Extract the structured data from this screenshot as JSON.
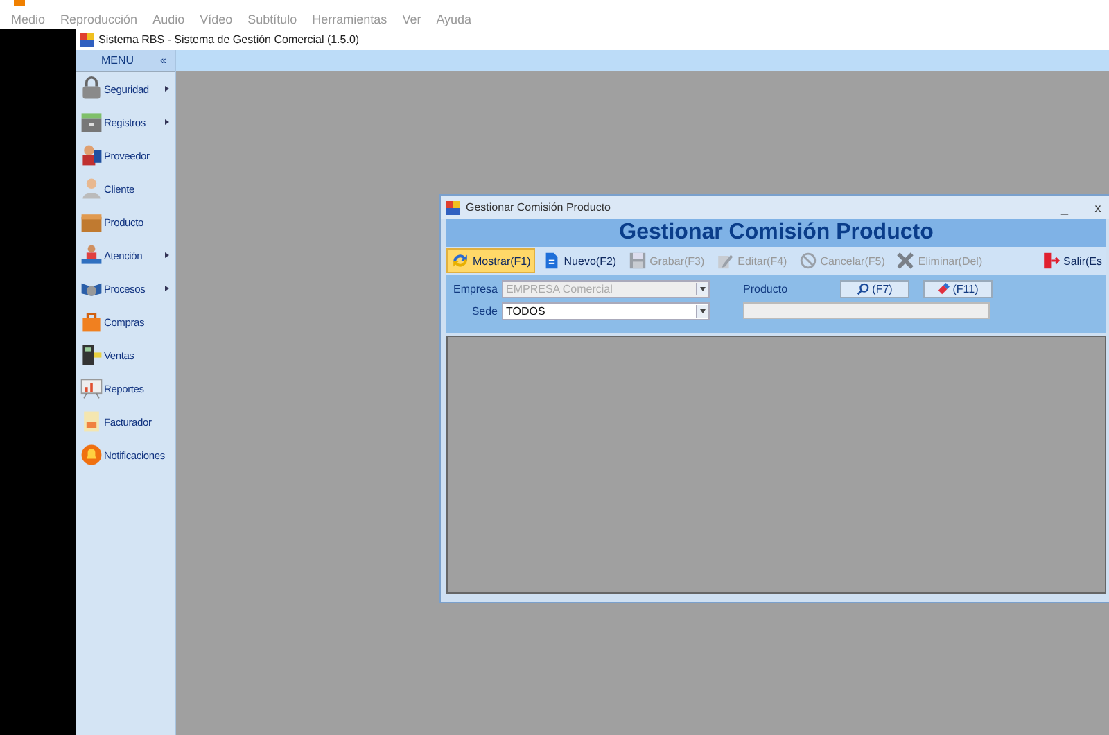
{
  "player_menu": [
    {
      "label": "Medio"
    },
    {
      "label": "Reproducción"
    },
    {
      "label": "Audio"
    },
    {
      "label": "Vídeo"
    },
    {
      "label": "Subtítulo"
    },
    {
      "label": "Herramientas"
    },
    {
      "label": "Ver"
    },
    {
      "label": "Ayuda"
    }
  ],
  "window": {
    "title": "Sistema RBS - Sistema de Gestión Comercial (1.5.0)"
  },
  "sidebar": {
    "header": "MENU",
    "collapse": "«",
    "items": [
      {
        "label": "Seguridad",
        "submenu": true
      },
      {
        "label": "Registros",
        "submenu": true
      },
      {
        "label": "Proveedor",
        "submenu": false
      },
      {
        "label": "Cliente",
        "submenu": false
      },
      {
        "label": "Producto",
        "submenu": false
      },
      {
        "label": "Atención",
        "submenu": true
      },
      {
        "label": "Procesos",
        "submenu": true
      },
      {
        "label": "Compras",
        "submenu": false
      },
      {
        "label": "Ventas",
        "submenu": false
      },
      {
        "label": "Reportes",
        "submenu": false
      },
      {
        "label": "Facturador",
        "submenu": false
      },
      {
        "label": "Notificaciones",
        "submenu": false
      }
    ]
  },
  "child_window": {
    "title": "Gestionar Comisión Producto",
    "minimize": "_",
    "close": "x",
    "heading": "Gestionar Comisión Producto",
    "toolbar": [
      {
        "label": "Mostrar(F1)",
        "selected": true,
        "disabled": false
      },
      {
        "label": "Nuevo(F2)",
        "selected": false,
        "disabled": false
      },
      {
        "label": "Grabar(F3)",
        "selected": false,
        "disabled": true
      },
      {
        "label": "Editar(F4)",
        "selected": false,
        "disabled": true
      },
      {
        "label": "Cancelar(F5)",
        "selected": false,
        "disabled": true
      },
      {
        "label": "Eliminar(Del)",
        "selected": false,
        "disabled": true
      }
    ],
    "exit": {
      "label": "Salir(Es"
    },
    "empresa": {
      "label": "Empresa",
      "value": "EMPRESA Comercial",
      "disabled": true
    },
    "sede": {
      "label": "Sede",
      "value": "TODOS",
      "disabled": false
    },
    "producto": {
      "label": "Producto",
      "search_button": "(F7)",
      "clear_button": "(F11)"
    }
  }
}
